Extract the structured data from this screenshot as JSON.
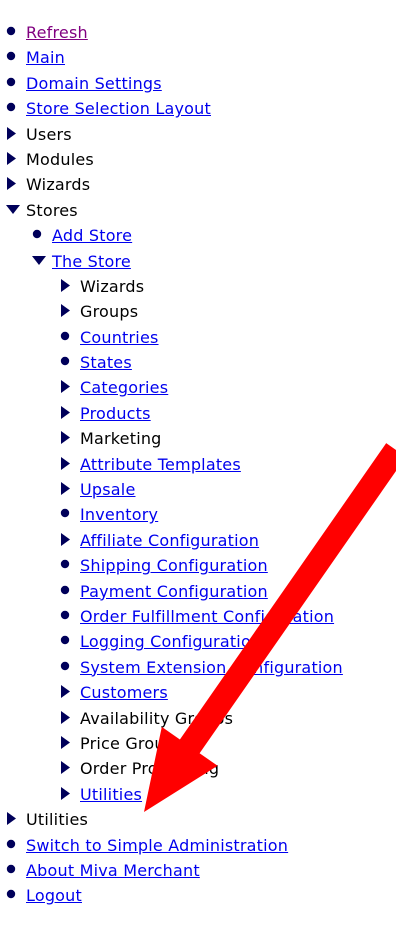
{
  "menu": {
    "items": [
      {
        "label": "Refresh",
        "level": 0,
        "icon": "bullet-icon",
        "link": true,
        "visited": true
      },
      {
        "label": "Main",
        "level": 0,
        "icon": "bullet-icon",
        "link": true
      },
      {
        "label": "Domain Settings",
        "level": 0,
        "icon": "bullet-icon",
        "link": true
      },
      {
        "label": "Store Selection Layout",
        "level": 0,
        "icon": "bullet-icon",
        "link": true
      },
      {
        "label": "Users",
        "level": 0,
        "icon": "collapsed-arrow-icon",
        "link": false
      },
      {
        "label": "Modules",
        "level": 0,
        "icon": "collapsed-arrow-icon",
        "link": false
      },
      {
        "label": "Wizards",
        "level": 0,
        "icon": "collapsed-arrow-icon",
        "link": false
      },
      {
        "label": "Stores",
        "level": 0,
        "icon": "expanded-arrow-icon",
        "link": false
      },
      {
        "label": "Add Store",
        "level": 1,
        "icon": "bullet-icon",
        "link": true
      },
      {
        "label": "The Store",
        "level": 1,
        "icon": "expanded-arrow-icon",
        "link": true
      },
      {
        "label": "Wizards",
        "level": 2,
        "icon": "collapsed-arrow-icon",
        "link": false
      },
      {
        "label": "Groups",
        "level": 2,
        "icon": "collapsed-arrow-icon",
        "link": false
      },
      {
        "label": "Countries",
        "level": 2,
        "icon": "bullet-icon",
        "link": true
      },
      {
        "label": "States",
        "level": 2,
        "icon": "bullet-icon",
        "link": true
      },
      {
        "label": "Categories",
        "level": 2,
        "icon": "collapsed-arrow-icon",
        "link": true
      },
      {
        "label": "Products",
        "level": 2,
        "icon": "collapsed-arrow-icon",
        "link": true
      },
      {
        "label": "Marketing",
        "level": 2,
        "icon": "collapsed-arrow-icon",
        "link": false
      },
      {
        "label": "Attribute Templates",
        "level": 2,
        "icon": "collapsed-arrow-icon",
        "link": true
      },
      {
        "label": "Upsale",
        "level": 2,
        "icon": "collapsed-arrow-icon",
        "link": true
      },
      {
        "label": "Inventory",
        "level": 2,
        "icon": "bullet-icon",
        "link": true
      },
      {
        "label": "Affiliate Configuration",
        "level": 2,
        "icon": "collapsed-arrow-icon",
        "link": true
      },
      {
        "label": "Shipping Configuration",
        "level": 2,
        "icon": "bullet-icon",
        "link": true
      },
      {
        "label": "Payment Configuration",
        "level": 2,
        "icon": "bullet-icon",
        "link": true
      },
      {
        "label": "Order Fulfillment Configuration",
        "level": 2,
        "icon": "bullet-icon",
        "link": true
      },
      {
        "label": "Logging Configuration",
        "level": 2,
        "icon": "bullet-icon",
        "link": true
      },
      {
        "label": "System Extension Configuration",
        "level": 2,
        "icon": "bullet-icon",
        "link": true
      },
      {
        "label": "Customers",
        "level": 2,
        "icon": "collapsed-arrow-icon",
        "link": true
      },
      {
        "label": "Availability Groups",
        "level": 2,
        "icon": "collapsed-arrow-icon",
        "link": false
      },
      {
        "label": "Price Groups",
        "level": 2,
        "icon": "collapsed-arrow-icon",
        "link": false
      },
      {
        "label": "Order Processing",
        "level": 2,
        "icon": "collapsed-arrow-icon",
        "link": false
      },
      {
        "label": "Utilities",
        "level": 2,
        "icon": "collapsed-arrow-icon",
        "link": true
      },
      {
        "label": "Utilities",
        "level": 0,
        "icon": "collapsed-arrow-icon",
        "link": false
      },
      {
        "label": "Switch to Simple Administration",
        "level": 0,
        "icon": "bullet-icon",
        "link": true
      },
      {
        "label": "About Miva Merchant",
        "level": 0,
        "icon": "bullet-icon",
        "link": true
      },
      {
        "label": "Logout",
        "level": 0,
        "icon": "bullet-icon",
        "link": true
      }
    ]
  },
  "colors": {
    "link": "#0000ee",
    "visited_link": "#800080",
    "text": "#000000",
    "icon": "#00005a",
    "annotation_arrow": "#ff0000"
  },
  "annotation": {
    "icon": "red-pointer-arrow-icon"
  }
}
